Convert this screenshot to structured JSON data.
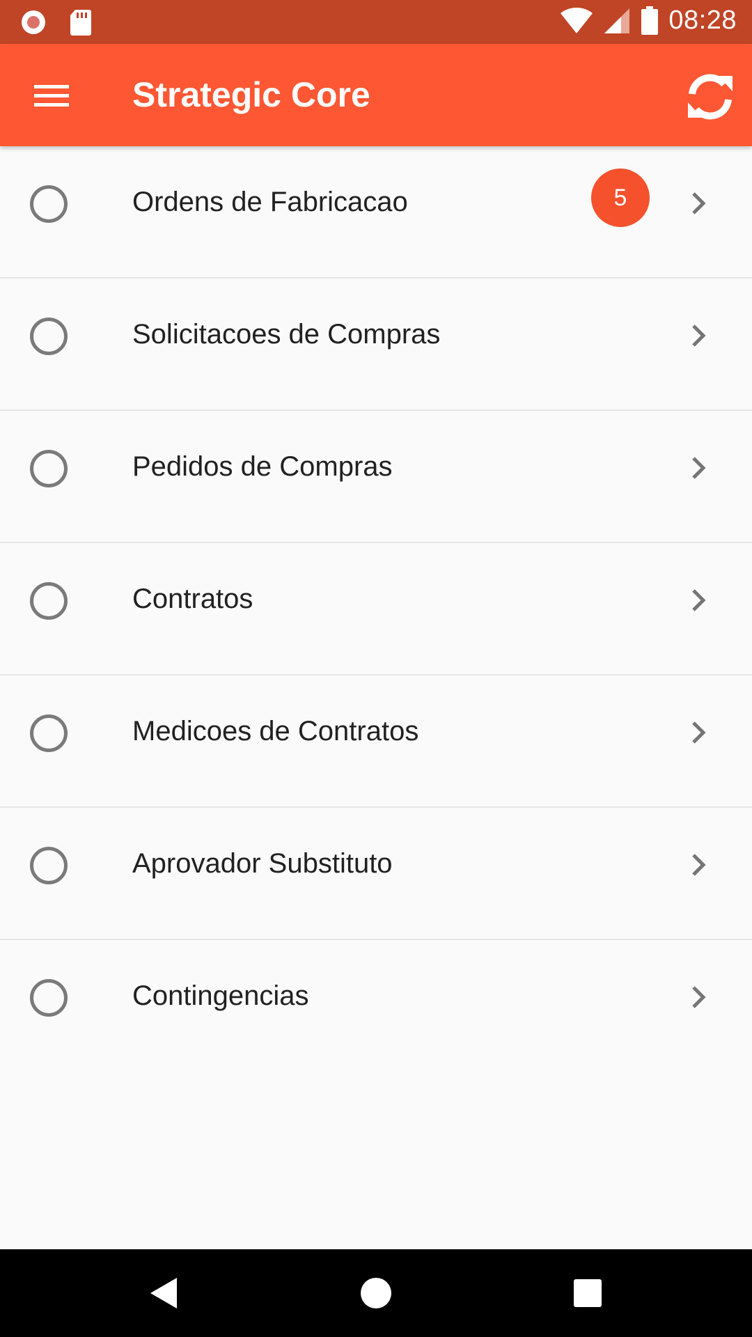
{
  "status_bar": {
    "time": "08:28",
    "icons": [
      "record-icon",
      "sd-card-icon",
      "wifi-icon",
      "signal-icon",
      "battery-icon"
    ]
  },
  "app_bar": {
    "title": "Strategic Core",
    "menu_icon": "hamburger-menu-icon",
    "refresh_icon": "refresh-icon",
    "background": "#fe5733"
  },
  "list": {
    "items": [
      {
        "label": "Ordens de Fabricacao",
        "badge": "5"
      },
      {
        "label": "Solicitacoes de Compras"
      },
      {
        "label": "Pedidos de Compras"
      },
      {
        "label": "Contratos"
      },
      {
        "label": "Medicoes de Contratos"
      },
      {
        "label": "Aprovador Substituto"
      },
      {
        "label": "Contingencias"
      }
    ],
    "badge_color": "#f4512c"
  },
  "nav_bar": {
    "icons": [
      "back-icon",
      "home-icon",
      "recents-icon"
    ]
  }
}
